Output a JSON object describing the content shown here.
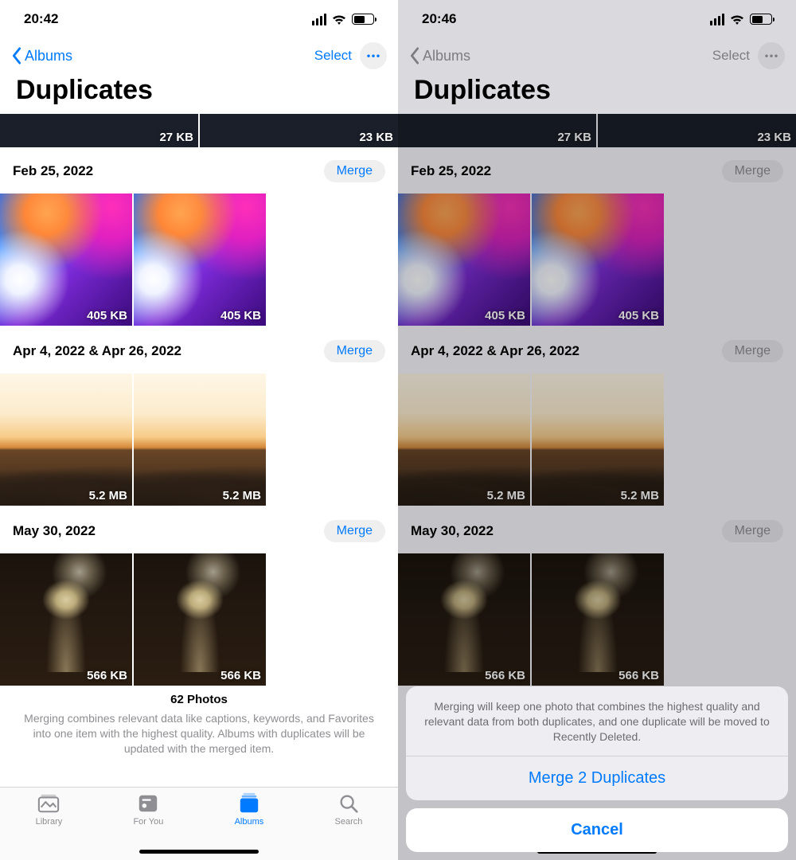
{
  "left": {
    "status": {
      "time": "20:42"
    },
    "nav": {
      "back": "Albums",
      "select": "Select"
    },
    "title": "Duplicates",
    "topRow": {
      "sizes": [
        "27 KB",
        "23 KB"
      ]
    },
    "groups": [
      {
        "date": "Feb 25, 2022",
        "merge": "Merge",
        "sizes": [
          "405 KB",
          "405 KB"
        ],
        "art": "gradient"
      },
      {
        "date": "Apr 4, 2022 & Apr 26, 2022",
        "merge": "Merge",
        "sizes": [
          "5.2 MB",
          "5.2 MB"
        ],
        "art": "sunset"
      },
      {
        "date": "May 30, 2022",
        "merge": "Merge",
        "sizes": [
          "566 KB",
          "566 KB"
        ],
        "art": "painting"
      }
    ],
    "footer": {
      "count": "62 Photos",
      "text": "Merging combines relevant data like captions, keywords, and Favorites into one item with the highest quality. Albums with duplicates will be updated with the merged item."
    },
    "tabs": [
      {
        "label": "Library"
      },
      {
        "label": "For You"
      },
      {
        "label": "Albums"
      },
      {
        "label": "Search"
      }
    ]
  },
  "right": {
    "status": {
      "time": "20:46"
    },
    "nav": {
      "back": "Albums",
      "select": "Select"
    },
    "title": "Duplicates",
    "topRow": {
      "sizes": [
        "27 KB",
        "23 KB"
      ]
    },
    "groups": [
      {
        "date": "Feb 25, 2022",
        "merge": "Merge",
        "sizes": [
          "405 KB",
          "405 KB"
        ],
        "art": "gradient"
      },
      {
        "date": "Apr 4, 2022 & Apr 26, 2022",
        "merge": "Merge",
        "sizes": [
          "5.2 MB",
          "5.2 MB"
        ],
        "art": "sunset"
      },
      {
        "date": "May 30, 2022",
        "merge": "Merge",
        "sizes": [
          "566 KB",
          "566 KB"
        ],
        "art": "painting"
      }
    ],
    "sheet": {
      "message": "Merging will keep one photo that combines the highest quality and relevant data from both duplicates, and one duplicate will be moved to Recently Deleted.",
      "action": "Merge 2 Duplicates",
      "cancel": "Cancel"
    }
  }
}
